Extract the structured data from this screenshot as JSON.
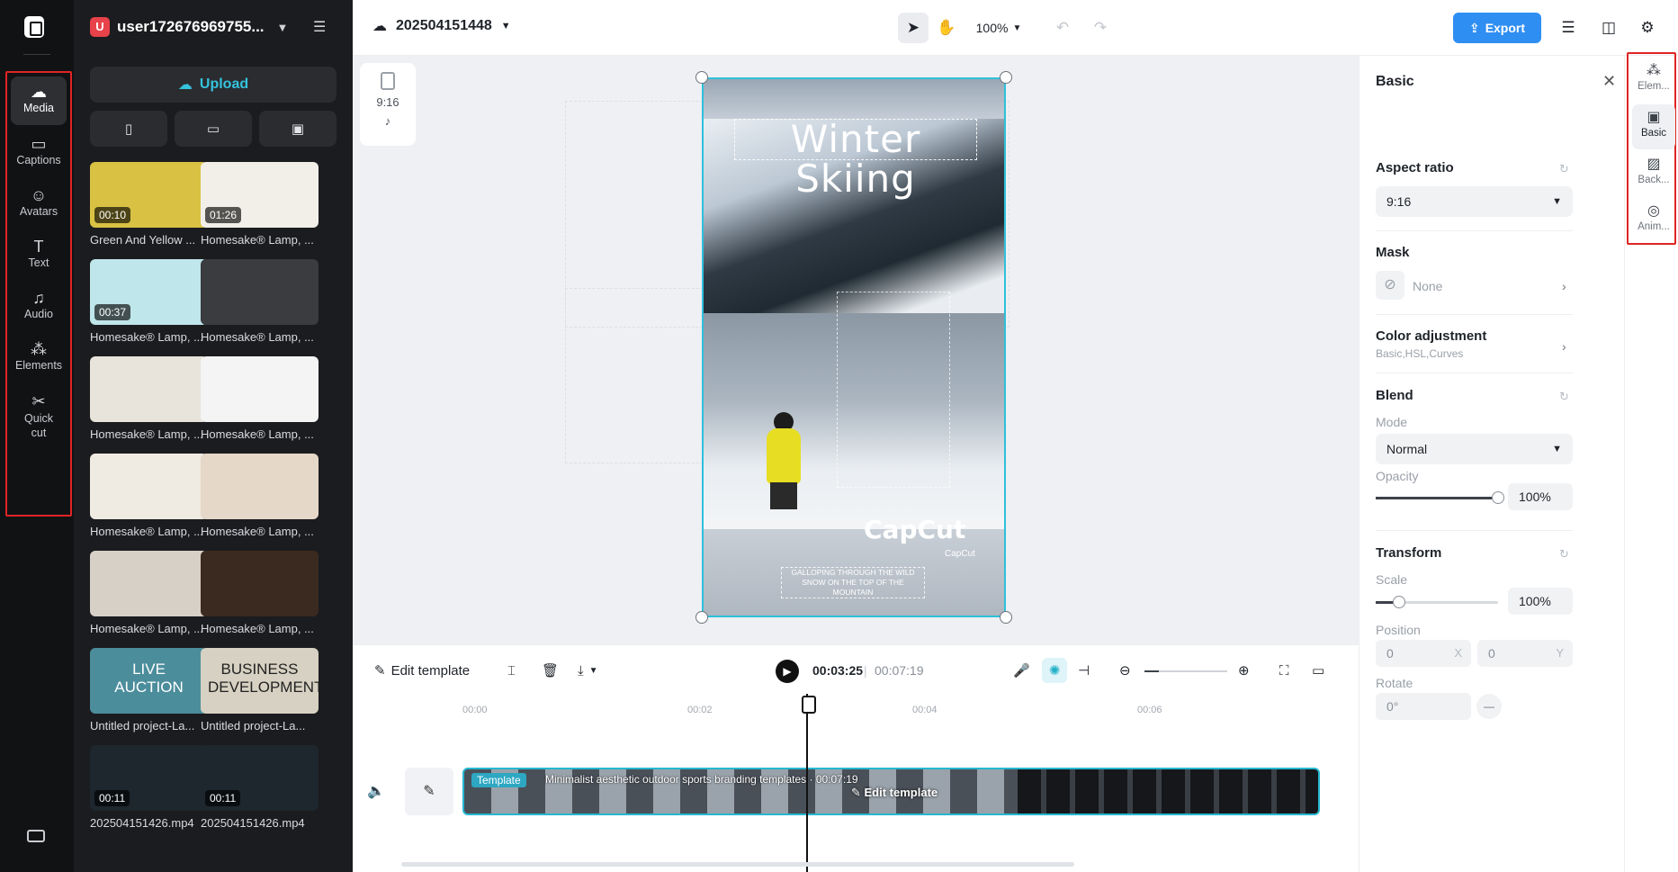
{
  "user": {
    "name": "user172676969755...",
    "initial": "U"
  },
  "rail": {
    "items": [
      {
        "label": "Media",
        "icon": "cloud-icon"
      },
      {
        "label": "Captions",
        "icon": "captions-icon"
      },
      {
        "label": "Avatars",
        "icon": "avatar-icon"
      },
      {
        "label": "Text",
        "icon": "text-icon"
      },
      {
        "label": "Audio",
        "icon": "music-note-icon"
      },
      {
        "label": "Elements",
        "icon": "elements-icon"
      },
      {
        "label": "Quick cut",
        "icon": "quick-cut-icon"
      }
    ]
  },
  "media": {
    "upload_label": "Upload",
    "items": [
      {
        "label": "Green And Yellow ...",
        "duration": "00:10"
      },
      {
        "label": "Homesake® Lamp, ...",
        "duration": "01:26"
      },
      {
        "label": "Homesake® Lamp, ...",
        "duration": "00:37"
      },
      {
        "label": "Homesake® Lamp, ...",
        "duration": ""
      },
      {
        "label": "Homesake® Lamp, ...",
        "duration": ""
      },
      {
        "label": "Homesake® Lamp, ...",
        "duration": ""
      },
      {
        "label": "Homesake® Lamp, ...",
        "duration": ""
      },
      {
        "label": "Homesake® Lamp, ...",
        "duration": ""
      },
      {
        "label": "Homesake® Lamp, ...",
        "duration": ""
      },
      {
        "label": "Homesake® Lamp, ...",
        "duration": ""
      },
      {
        "label": "Untitled project-La...",
        "duration": "",
        "thumb_text": "LIVE AUCTION"
      },
      {
        "label": "Untitled project-La...",
        "duration": "",
        "thumb_text": "BUSINESS DEVELOPMENT"
      },
      {
        "label": "202504151426.mp4",
        "duration": "00:11"
      },
      {
        "label": "202504151426.mp4",
        "duration": "00:11"
      }
    ]
  },
  "topbar": {
    "project_name": "202504151448",
    "zoom": "100%",
    "export_label": "Export"
  },
  "canvas": {
    "ratio_label": "9:16",
    "video_title": "Winter Skiing",
    "brand": "CapCut",
    "brand_small": "CapCut",
    "tagline_1": "GALLOPING THROUGH THE WILD",
    "tagline_2": "SNOW ON THE TOP OF THE MOUNTAIN"
  },
  "timeline": {
    "edit_template_label": "Edit template",
    "current_time": "00:03:25",
    "separator": "|",
    "total_time": "00:07:19",
    "ruler": [
      "00:00",
      "00:02",
      "00:04",
      "00:06"
    ],
    "clip_badge": "Template",
    "clip_name": "Minimalist aesthetic outdoor sports branding templates",
    "clip_duration": "00:07:19",
    "clip_edit_label": "Edit template"
  },
  "props": {
    "title": "Basic",
    "aspect_ratio": {
      "title": "Aspect ratio",
      "value": "9:16"
    },
    "mask": {
      "title": "Mask",
      "value": "None"
    },
    "color_adjustment": {
      "title": "Color adjustment",
      "subtitle": "Basic,HSL,Curves"
    },
    "blend": {
      "title": "Blend",
      "mode_label": "Mode",
      "mode_value": "Normal",
      "opacity_label": "Opacity",
      "opacity_value": "100%",
      "opacity_fraction": 1.0
    },
    "transform": {
      "title": "Transform",
      "scale_label": "Scale",
      "scale_value": "100%",
      "position_label": "Position",
      "pos_x": "0",
      "pos_y": "0",
      "x_axis": "X",
      "y_axis": "Y",
      "rotate_label": "Rotate",
      "rotate_value": "0°"
    }
  },
  "tabs": [
    {
      "label": "Elem...",
      "icon": "elements-icon"
    },
    {
      "label": "Basic",
      "icon": "basic-icon"
    },
    {
      "label": "Back...",
      "icon": "background-icon"
    },
    {
      "label": "Anim...",
      "icon": "animation-icon"
    }
  ]
}
